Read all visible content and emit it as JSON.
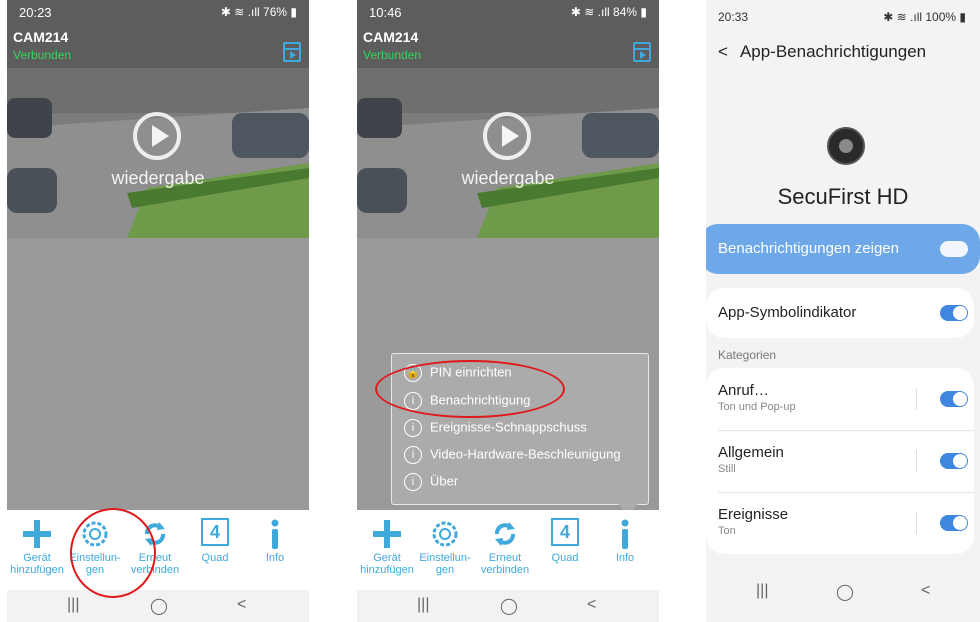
{
  "phones": [
    {
      "status": {
        "time": "20:23",
        "right": "✱ ≋ .ıll 76% ▮"
      },
      "camera": {
        "name": "CAM214",
        "status": "Verbunden"
      },
      "video": {
        "play_label": "wiedergabe"
      },
      "toolbar": [
        {
          "label1": "Gerät",
          "label2": "hinzufügen"
        },
        {
          "label1": "Einstellun-",
          "label2": "gen"
        },
        {
          "label1": "Erneut",
          "label2": "verbinden"
        },
        {
          "label1": "Quad",
          "label2": "",
          "glyph": "4"
        },
        {
          "label1": "Info",
          "label2": ""
        }
      ],
      "nav": {
        "recents": "|||",
        "home": "◯",
        "back": "<"
      }
    },
    {
      "status": {
        "time": "10:46",
        "right": "✱ ≋ .ıll 84% ▮"
      },
      "camera": {
        "name": "CAM214",
        "status": "Verbunden"
      },
      "video": {
        "play_label": "wiedergabe"
      },
      "popup": [
        {
          "label": "PIN einrichten"
        },
        {
          "label": "Benachrichtigung"
        },
        {
          "label": "Ereignisse-Schnappschuss"
        },
        {
          "label": "Video-Hardware-Beschleunigung"
        },
        {
          "label": "Über"
        }
      ],
      "toolbar": [
        {
          "label1": "Gerät",
          "label2": "hinzufügen"
        },
        {
          "label1": "Einstellun-",
          "label2": "gen"
        },
        {
          "label1": "Erneut",
          "label2": "verbinden"
        },
        {
          "label1": "Quad",
          "label2": "",
          "glyph": "4"
        },
        {
          "label1": "Info",
          "label2": ""
        }
      ],
      "nav": {
        "recents": "|||",
        "home": "◯",
        "back": "<"
      }
    }
  ],
  "settings": {
    "status": {
      "time": "20:33",
      "right": "✱ ≋ .ıll 100% ▮"
    },
    "header": "App-Benachrichtigungen",
    "app_name": "SecuFirst HD",
    "show_notifications": "Benachrichtigungen zeigen",
    "badge": "App-Symbolindikator",
    "categories_label": "Kategorien",
    "categories": [
      {
        "name": "Anruf…",
        "sub": "Ton und Pop-up"
      },
      {
        "name": "Allgemein",
        "sub": "Still"
      },
      {
        "name": "Ereignisse",
        "sub": "Ton"
      }
    ],
    "nav": {
      "recents": "|||",
      "home": "◯",
      "back": "<"
    }
  },
  "colors": {
    "accent": "#3fa9dc",
    "connected": "#32d65a",
    "highlight": "#e0191b",
    "toggle": "#3f86e0",
    "notify_card": "#6ea8e8"
  }
}
